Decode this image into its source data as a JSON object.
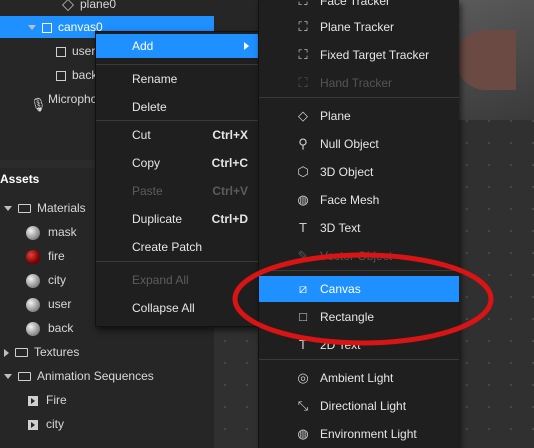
{
  "scene": {
    "plane0": "plane0",
    "canvas": "canvas0",
    "user": "user",
    "back": "back",
    "microphone": "Micropho"
  },
  "assets": {
    "header": "Assets",
    "materials_folder": "Materials",
    "materials": [
      "mask",
      "fire",
      "city",
      "user",
      "back"
    ],
    "textures_folder": "Textures",
    "animation_folder": "Animation Sequences",
    "sequences": [
      "Fire",
      "city"
    ]
  },
  "context_menu": {
    "add": "Add",
    "rename": "Rename",
    "delete": "Delete",
    "cut": "Cut",
    "cut_shortcut": "Ctrl+X",
    "copy": "Copy",
    "copy_shortcut": "Ctrl+C",
    "paste": "Paste",
    "paste_shortcut": "Ctrl+V",
    "duplicate": "Duplicate",
    "duplicate_shortcut": "Ctrl+D",
    "create_patch": "Create Patch",
    "expand_all": "Expand All",
    "collapse_all": "Collapse All"
  },
  "submenu": {
    "face_tracker": "Face Tracker",
    "plane_tracker": "Plane Tracker",
    "fixed_target_tracker": "Fixed Target Tracker",
    "hand_tracker": "Hand Tracker",
    "plane": "Plane",
    "null_object": "Null Object",
    "object_3d": "3D Object",
    "face_mesh": "Face Mesh",
    "text_3d": "3D Text",
    "vector_object": "Vector Object",
    "canvas": "Canvas",
    "rectangle": "Rectangle",
    "text_2d": "2D Text",
    "ambient_light": "Ambient Light",
    "directional_light": "Directional Light",
    "environment_light": "Environment Light"
  },
  "colors": {
    "highlight": "#1e90ff",
    "annotation": "#d81414",
    "fire_material": "#8a0000"
  }
}
